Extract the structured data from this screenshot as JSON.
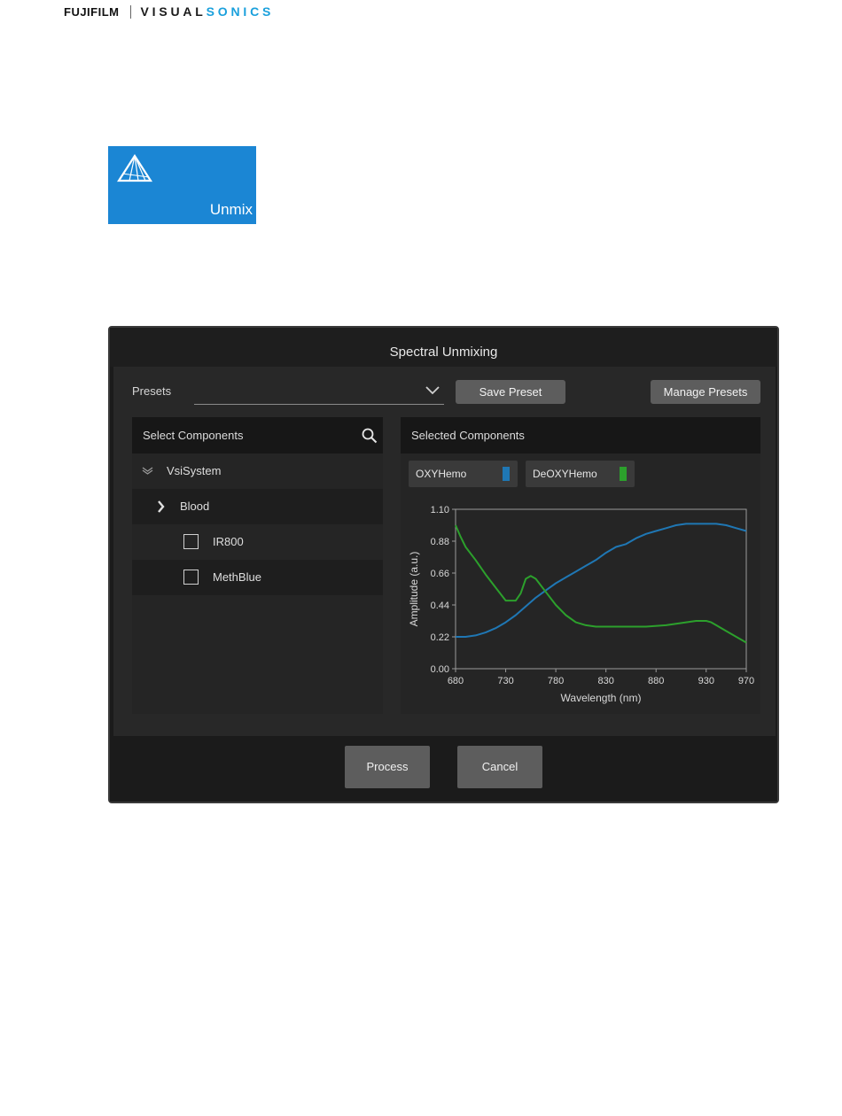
{
  "logo": {
    "brand1": "FUJIFILM",
    "brand2a": "VISUAL",
    "brand2b": "SONICS"
  },
  "tile": {
    "label": "Unmix",
    "color": "#1b86d4"
  },
  "dialog": {
    "title": "Spectral Unmixing",
    "presets": {
      "label": "Presets",
      "value": ""
    },
    "save_label": "Save Preset",
    "manage_label": "Manage Presets",
    "left": {
      "header": "Select Components",
      "tree": [
        {
          "label": "VsiSystem",
          "state": "expanded"
        },
        {
          "label": "Blood",
          "state": "collapsed"
        },
        {
          "label": "IR800",
          "checked": false
        },
        {
          "label": "MethBlue",
          "checked": false
        }
      ]
    },
    "right": {
      "header": "Selected Components",
      "chips": [
        {
          "label": "OXYHemo",
          "color": "#1f77b4"
        },
        {
          "label": "DeOXYHemo",
          "color": "#2ca02c"
        }
      ]
    },
    "process_label": "Process",
    "cancel_label": "Cancel"
  },
  "chart_data": {
    "type": "line",
    "xlabel": "Wavelength (nm)",
    "ylabel": "Amplitude (a.u.)",
    "xlim": [
      680,
      970
    ],
    "ylim": [
      0,
      1.1
    ],
    "xticks": [
      680,
      730,
      780,
      830,
      880,
      930,
      970
    ],
    "yticks": [
      "0.00",
      "0.22",
      "0.44",
      "0.66",
      "0.88",
      "1.10"
    ],
    "series": [
      {
        "name": "OXYHemo",
        "color": "#1f77b4",
        "x": [
          680,
          690,
          700,
          710,
          720,
          730,
          740,
          750,
          760,
          770,
          780,
          790,
          800,
          810,
          820,
          830,
          840,
          850,
          860,
          870,
          880,
          890,
          900,
          910,
          920,
          930,
          940,
          950,
          960,
          970
        ],
        "y": [
          0.22,
          0.22,
          0.23,
          0.25,
          0.28,
          0.32,
          0.37,
          0.43,
          0.49,
          0.54,
          0.59,
          0.63,
          0.67,
          0.71,
          0.75,
          0.8,
          0.84,
          0.86,
          0.9,
          0.93,
          0.95,
          0.97,
          0.99,
          1.0,
          1.0,
          1.0,
          1.0,
          0.99,
          0.97,
          0.95
        ]
      },
      {
        "name": "DeOXYHemo",
        "color": "#2ca02c",
        "x": [
          680,
          685,
          690,
          700,
          710,
          720,
          730,
          735,
          740,
          745,
          750,
          755,
          760,
          770,
          780,
          790,
          800,
          810,
          820,
          830,
          850,
          870,
          890,
          900,
          910,
          920,
          930,
          935,
          940,
          950,
          960,
          970
        ],
        "y": [
          0.99,
          0.91,
          0.84,
          0.75,
          0.65,
          0.56,
          0.47,
          0.47,
          0.47,
          0.52,
          0.62,
          0.64,
          0.62,
          0.53,
          0.44,
          0.37,
          0.32,
          0.3,
          0.29,
          0.29,
          0.29,
          0.29,
          0.3,
          0.31,
          0.32,
          0.33,
          0.33,
          0.32,
          0.3,
          0.26,
          0.22,
          0.18
        ]
      }
    ],
    "grid": false
  }
}
